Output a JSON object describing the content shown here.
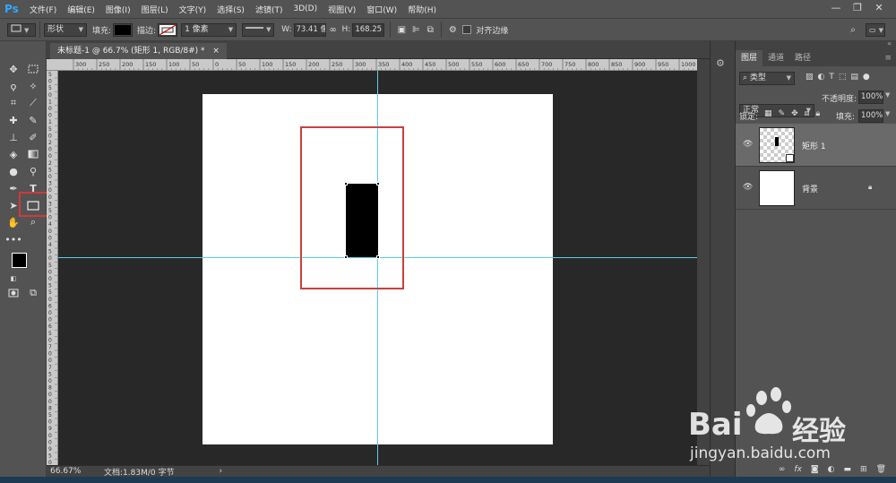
{
  "app": {
    "logo": "Ps",
    "menu": [
      "文件(F)",
      "编辑(E)",
      "图像(I)",
      "图层(L)",
      "文字(Y)",
      "选择(S)",
      "滤镜(T)",
      "3D(D)",
      "视图(V)",
      "窗口(W)",
      "帮助(H)"
    ],
    "window_controls": [
      "minimize-icon",
      "restore-icon",
      "close-icon"
    ]
  },
  "options": {
    "mode": "形状",
    "fill_label": "填充:",
    "fill_color": "#000000",
    "stroke_label": "描边:",
    "stroke_width": "1 像素",
    "w_label": "W:",
    "w_value": "73.41 像",
    "link_icon": "link-icon",
    "h_label": "H:",
    "h_value": "168.25 |",
    "align_edges": "对齐边缘"
  },
  "document": {
    "tab_title": "未标题-1 @ 66.7% (矩形 1, RGB/8#) *",
    "close": "×",
    "zoom": "66.67%",
    "doc_info": "文档:1.83M/0 字节",
    "doc_info_arrow": "›"
  },
  "ruler": {
    "h_labels": [
      "300",
      "250",
      "200",
      "150",
      "100",
      "50",
      "0",
      "50",
      "100",
      "150",
      "200",
      "250",
      "300",
      "350",
      "400",
      "450",
      "500",
      "550",
      "600",
      "650",
      "700",
      "750",
      "800",
      "850",
      "900",
      "950",
      "1000",
      "1050"
    ],
    "v_labels": [
      "5",
      "0",
      "5",
      "0",
      "1",
      "0",
      "0",
      "1",
      "5",
      "0",
      "2",
      "0",
      "0",
      "2",
      "5",
      "0",
      "3",
      "0",
      "0",
      "3",
      "5",
      "0",
      "4",
      "0",
      "0",
      "4",
      "5",
      "0",
      "5",
      "0",
      "0",
      "5",
      "5",
      "0",
      "6",
      "0",
      "0",
      "6",
      "5",
      "0",
      "7",
      "0",
      "0",
      "7",
      "5",
      "0",
      "8",
      "0",
      "0",
      "8",
      "5",
      "0",
      "9",
      "0",
      "0",
      "9",
      "5",
      "0"
    ]
  },
  "layers_panel": {
    "tabs": [
      "图层",
      "通道",
      "路径"
    ],
    "filter_kind": "类型",
    "blend_mode": "正常",
    "opacity_label": "不透明度:",
    "opacity_value": "100%",
    "lock_label": "锁定:",
    "fill_label": "填充:",
    "fill_value": "100%",
    "layers": [
      {
        "name": "矩形 1",
        "selected": true
      },
      {
        "name": "背景",
        "selected": false,
        "locked": true
      }
    ],
    "bottom_icons": [
      "link-layers-icon",
      "fx-icon",
      "mask-icon",
      "adjustment-icon",
      "group-icon",
      "new-layer-icon",
      "trash-icon"
    ]
  },
  "watermark": {
    "brand": "Bai",
    "brand_cn": "经验",
    "url": "jingyan.baidu.com"
  },
  "colors": {
    "guide": "#5ad0e0",
    "highlight": "#d0393a",
    "canvas_bg": "#ffffff",
    "pasteboard": "#282828"
  }
}
